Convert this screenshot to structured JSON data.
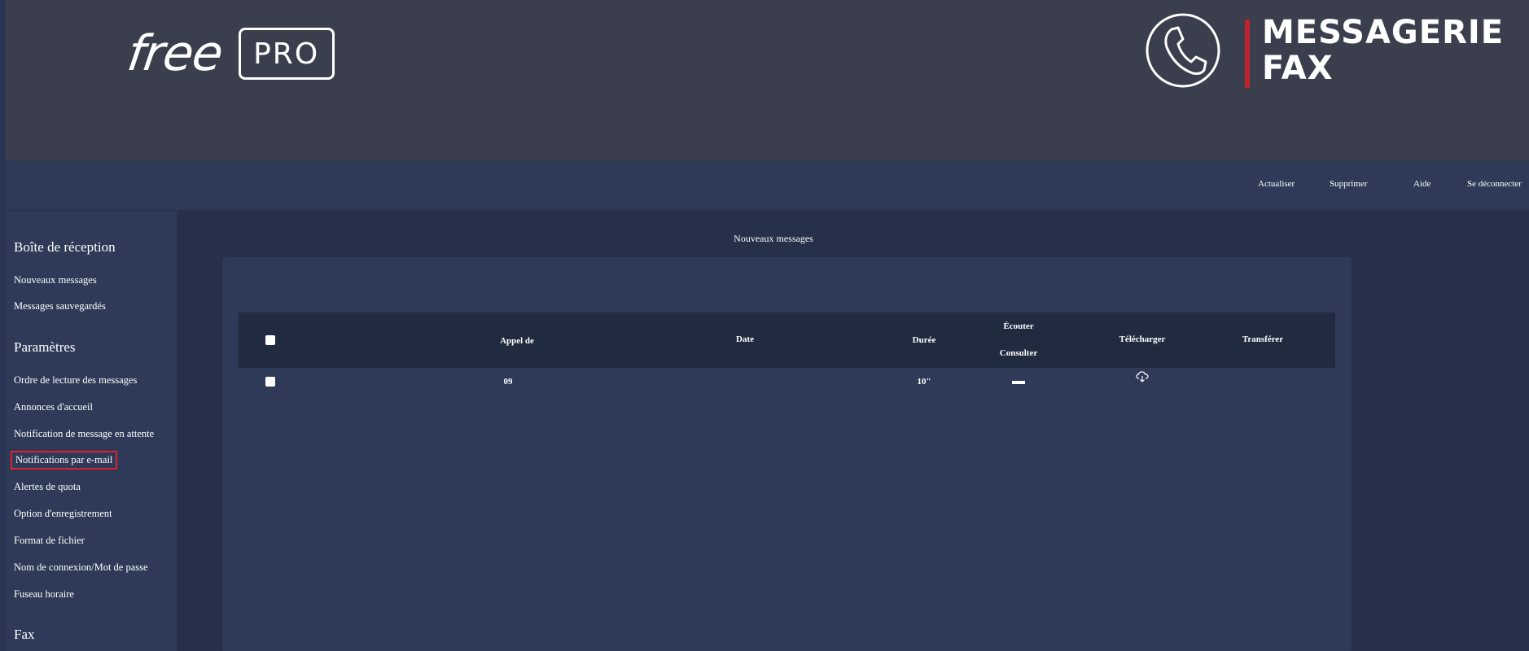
{
  "header": {
    "logo_free": "free",
    "logo_pro": "PRO",
    "brand_line1": "MESSAGERIE",
    "brand_line2": "FAX",
    "brand_accent": "#c0222e"
  },
  "nav": {
    "refresh": "Actualiser",
    "delete": "Supprimer",
    "help": "Aide",
    "logout": "Se déconnecter"
  },
  "sidebar": {
    "inbox_heading": "Boîte de réception",
    "inbox_items": [
      "Nouveaux messages",
      "Messages sauvegardés"
    ],
    "settings_heading": "Paramètres",
    "settings_items": [
      "Ordre de lecture des messages",
      "Annonces d'accueil",
      "Notification de message en attente",
      "Notifications par e-mail",
      "Alertes de quota",
      "Option d'enregistrement",
      "Format de fichier",
      "Nom de connexion/Mot de passe",
      "Fuseau horaire"
    ],
    "fax_heading": "Fax"
  },
  "main": {
    "title": "Nouveaux messages",
    "columns": {
      "caller": "Appel de",
      "date": "Date",
      "duration": "Durée",
      "listen": "Écouter",
      "view": "Consulter",
      "download": "Télécharger",
      "transfer": "Transférer"
    },
    "rows": [
      {
        "caller": "09",
        "date": "",
        "duration": "10\"",
        "listen_icon": "play-bar-icon",
        "download_icon": "cloud-download-icon"
      }
    ]
  }
}
